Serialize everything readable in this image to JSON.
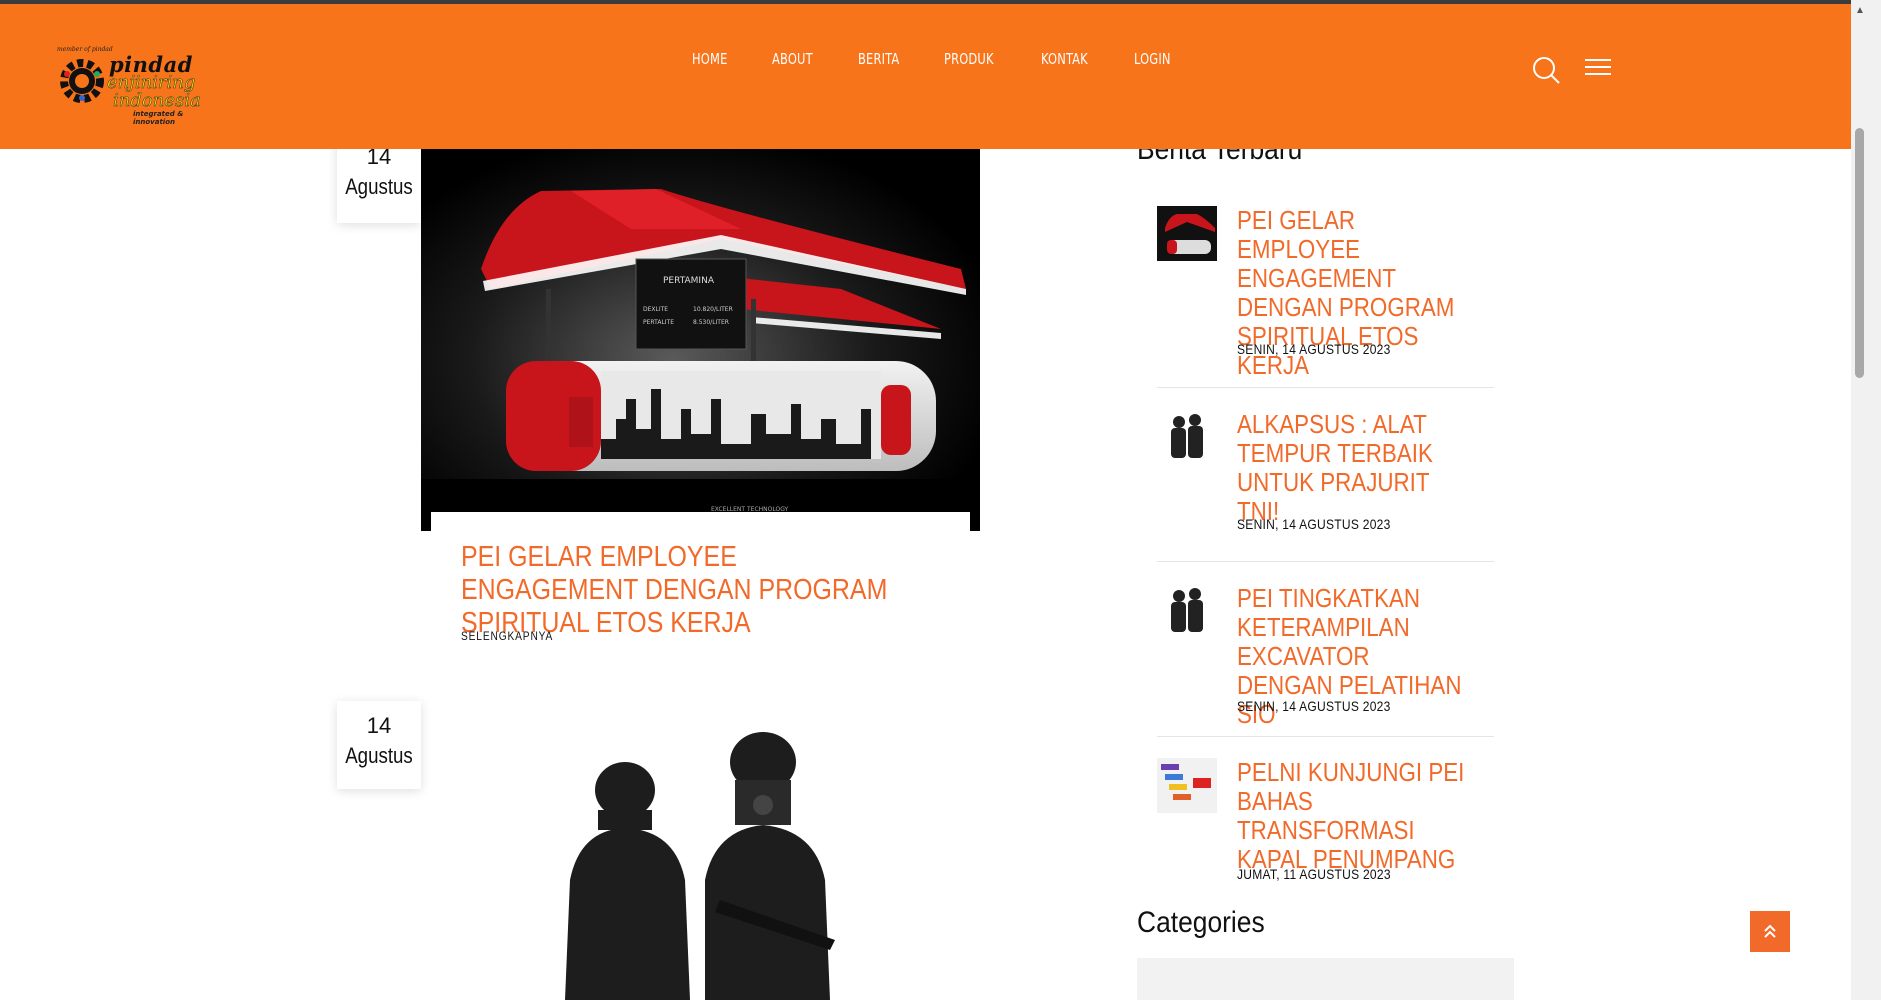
{
  "header": {
    "logo": {
      "tag": "member of pindad",
      "line1": "pindad",
      "line2": "enjiniring",
      "line3": "indonesia",
      "line4": "integrated & innovation"
    },
    "nav": [
      "HOME",
      "ABOUT",
      "BERITA",
      "PRODUK",
      "KONTAK",
      "LOGIN"
    ]
  },
  "posts": [
    {
      "day": "14",
      "month": "Agustus",
      "title": "PEI GELAR EMPLOYEE ENGAGEMENT DENGAN PROGRAM SPIRITUAL ETOS KERJA",
      "read_more": "SELENGKAPNYA",
      "image": {
        "brand": "PERTAMINA",
        "price1_label": "DEXLITE",
        "price1_value": "10.820/LITER",
        "price2_label": "PERTALITE",
        "price2_value": "8.530/LITER",
        "footer": "EXCELLENT TECHNOLOGY"
      }
    },
    {
      "day": "14",
      "month": "Agustus"
    }
  ],
  "sidebar": {
    "recent_heading": "Berita Terbaru",
    "recent": [
      {
        "title": "PEI GELAR EMPLOYEE ENGAGEMENT DENGAN PROGRAM SPIRITUAL ETOS KERJA",
        "date": "SENIN, 14 AGUSTUS 2023"
      },
      {
        "title": "ALKAPSUS : ALAT TEMPUR TERBAIK UNTUK PRAJURIT TNI!",
        "date": "SENIN, 14 AGUSTUS 2023"
      },
      {
        "title": "PEI TINGKATKAN KETERAMPILAN EXCAVATOR DENGAN PELATIHAN SIO",
        "date": "SENIN, 14 AGUSTUS 2023"
      },
      {
        "title": "PELNI KUNJUNGI PEI BAHAS TRANSFORMASI KAPAL PENUMPANG",
        "date": "JUMAT, 11 AGUSTUS 2023"
      }
    ],
    "categories_heading": "Categories"
  },
  "colors": {
    "header": "#f7741b",
    "accent": "#f26a2a"
  },
  "icons": [
    "search-icon",
    "hamburger-menu-icon",
    "chevron-double-up-icon"
  ]
}
